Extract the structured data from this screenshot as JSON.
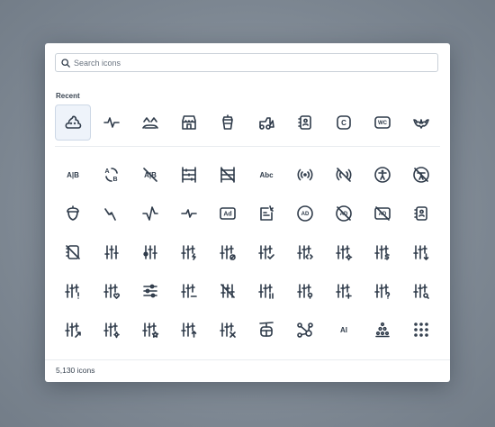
{
  "search": {
    "placeholder": "Search icons",
    "value": ""
  },
  "recent_label": "Recent",
  "footer": {
    "count": "5,130 icons"
  },
  "recent_icons": [
    "poo-icon",
    "heartbeat-icon",
    "mood-crazy-icon",
    "building-store-icon",
    "cup-icon",
    "bulldozer-icon",
    "address-book-icon",
    "letter-c-icon",
    "wc-icon",
    "bat-icon"
  ],
  "grid_icons": [
    [
      "a-b-icon",
      "a-b-2-icon",
      "a-b-off-icon",
      "abacus-icon",
      "abacus-off-icon",
      "abc-icon",
      "access-point-icon",
      "access-point-off-icon",
      "accessible-icon",
      "accessible-off-icon"
    ],
    [
      "acorn-icon",
      "activity-heartbeat-icon",
      "activity-icon",
      "activity-2-icon",
      "ad-icon",
      "ad-2-icon",
      "ad-circle-icon",
      "ad-circle-off-icon",
      "ad-off-icon",
      "address-book-2-icon"
    ],
    [
      "address-book-off-icon",
      "adjustments-icon",
      "adjustments-alt-icon",
      "adjustments-bolt-icon",
      "adjustments-cancel-icon",
      "adjustments-check-icon",
      "adjustments-code-icon",
      "adjustments-cog-icon",
      "adjustments-dollar-icon",
      "adjustments-down-icon"
    ],
    [
      "adjustments-exclamation-icon",
      "adjustments-heart-icon",
      "adjustments-horizontal-icon",
      "adjustments-minus-icon",
      "adjustments-off-icon",
      "adjustments-pause-icon",
      "adjustments-pin-icon",
      "adjustments-plus-icon",
      "adjustments-question-icon",
      "adjustments-search-icon"
    ],
    [
      "adjustments-share-icon",
      "adjustments-spark-icon",
      "adjustments-star-icon",
      "adjustments-up-icon",
      "adjustments-x-icon",
      "aerial-lift-icon",
      "affiliate-icon",
      "ai-icon",
      "air-balloon-icon",
      "air-conditioning-icon"
    ]
  ],
  "text_glyphs": {
    "a-b": "A|B",
    "abc": "Abc",
    "ad": "Ad",
    "ai": "AI",
    "wc": "WC",
    "c": "C",
    "ad-circle": "AD"
  }
}
